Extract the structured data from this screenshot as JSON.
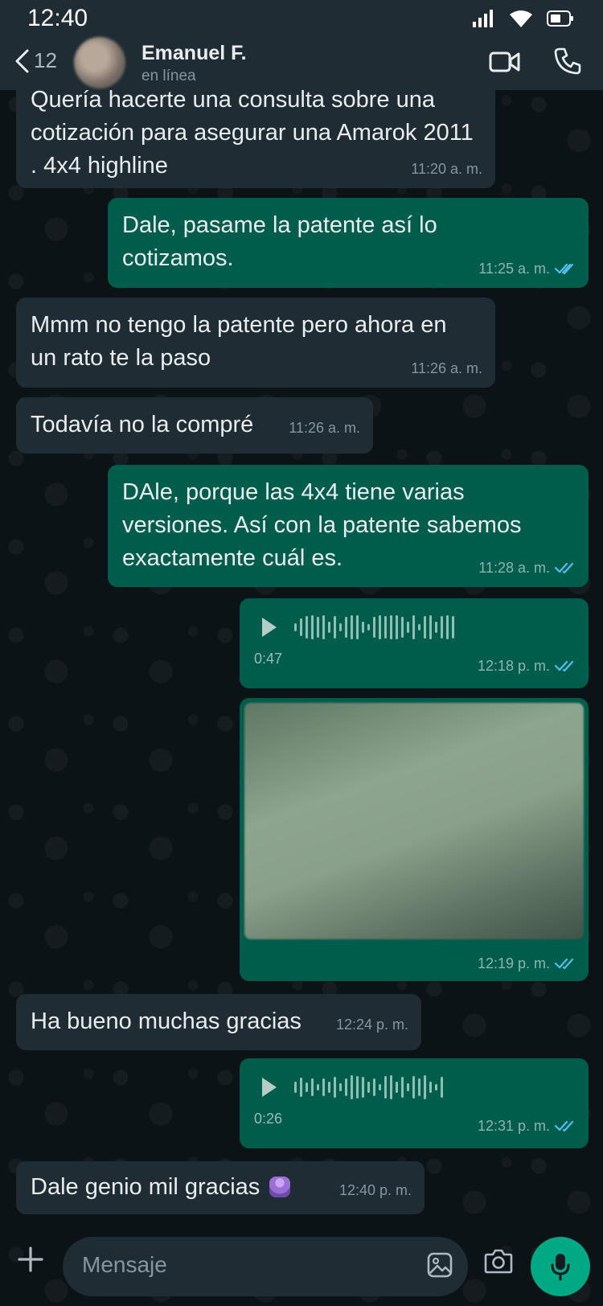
{
  "status_bar": {
    "time": "12:40"
  },
  "header": {
    "back_count": "12",
    "contact_name": "Emanuel F.",
    "contact_status": "en línea"
  },
  "messages": [
    {
      "dir": "in",
      "text": "Quería hacerte una consulta sobre una cotización para asegurar una Amarok 2011 . 4x4 highline",
      "time": "11:20 a. m."
    },
    {
      "dir": "out",
      "text": "Dale, pasame la patente así lo cotizamos.",
      "time": "11:25 a. m."
    },
    {
      "dir": "in",
      "text": "Mmm no tengo la patente pero ahora en un rato te la paso",
      "time": "11:26 a. m."
    },
    {
      "dir": "in",
      "text": "Todavía no la compré",
      "time": "11:26 a. m."
    },
    {
      "dir": "out",
      "text": "DAle, porque las 4x4 tiene varias versiones. Así con la patente sabemos exactamente cuál es.",
      "time": "11:28 a. m."
    },
    {
      "dir": "out",
      "type": "audio",
      "duration": "0:47",
      "time": "12:18 p. m."
    },
    {
      "dir": "out",
      "type": "image",
      "time": "12:19 p. m."
    },
    {
      "dir": "in",
      "text": "Ha bueno muchas gracias",
      "time": "12:24 p. m."
    },
    {
      "dir": "out",
      "type": "audio",
      "duration": "0:26",
      "time": "12:31 p. m."
    },
    {
      "dir": "in",
      "text": "Dale genio mil gracias",
      "time": "12:40 p. m."
    }
  ],
  "composer": {
    "placeholder": "Mensaje"
  },
  "colors": {
    "incoming": "#1f2c34",
    "outgoing": "#005c4b",
    "accent": "#00a884",
    "read_tick": "#53bdeb"
  }
}
